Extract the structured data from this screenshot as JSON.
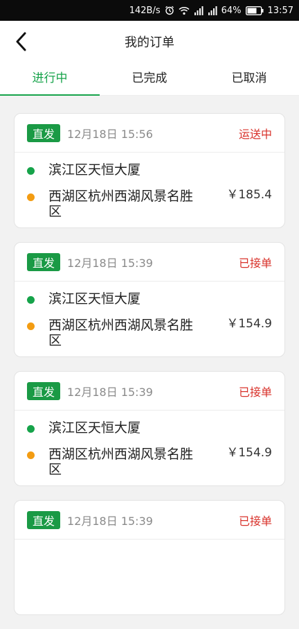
{
  "status_bar": {
    "speed": "142B/s",
    "battery": "64%",
    "time": "13:57"
  },
  "header": {
    "title": "我的订单"
  },
  "tabs": [
    {
      "label": "进行中",
      "active": true
    },
    {
      "label": "已完成",
      "active": false
    },
    {
      "label": "已取消",
      "active": false
    }
  ],
  "orders": [
    {
      "badge": "直发",
      "time": "12月18日 15:56",
      "status": "运送中",
      "from": "滨江区天恒大厦",
      "to": "西湖区杭州西湖风景名胜区",
      "price": "￥185.4"
    },
    {
      "badge": "直发",
      "time": "12月18日 15:39",
      "status": "已接单",
      "from": "滨江区天恒大厦",
      "to": "西湖区杭州西湖风景名胜区",
      "price": "￥154.9"
    },
    {
      "badge": "直发",
      "time": "12月18日 15:39",
      "status": "已接单",
      "from": "滨江区天恒大厦",
      "to": "西湖区杭州西湖风景名胜区",
      "price": "￥154.9"
    },
    {
      "badge": "直发",
      "time": "12月18日 15:39",
      "status": "已接单"
    }
  ],
  "colors": {
    "accent": "#16a34a",
    "status_red": "#d8312a",
    "origin_dot": "#16a34a",
    "destination_dot": "#f39c12"
  }
}
